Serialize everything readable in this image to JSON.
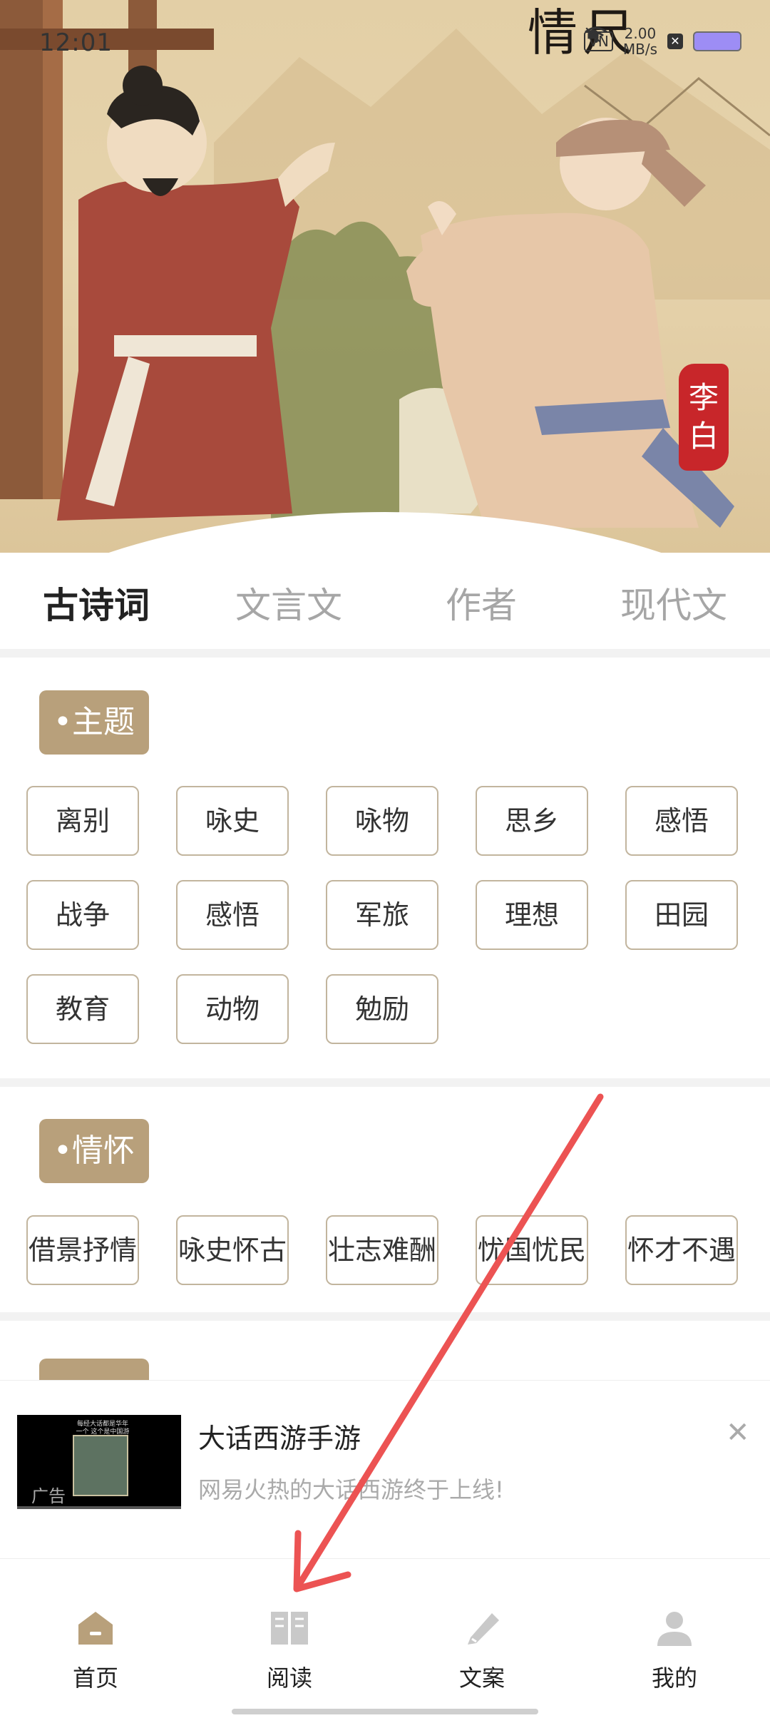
{
  "status_bar": {
    "time": "12:01",
    "vpn": "VN",
    "net_speed_value": "2.00",
    "net_speed_unit": "MB/s"
  },
  "hero": {
    "title_text": "情尺",
    "seal_line1": "李",
    "seal_line2": "白"
  },
  "tabs": [
    {
      "label": "古诗词",
      "active": true
    },
    {
      "label": "文言文",
      "active": false
    },
    {
      "label": "作者",
      "active": false
    },
    {
      "label": "现代文",
      "active": false
    }
  ],
  "sections": [
    {
      "label": "•主题",
      "chips": [
        "离别",
        "咏史",
        "咏物",
        "思乡",
        "感悟",
        "战争",
        "感悟",
        "军旅",
        "理想",
        "田园",
        "教育",
        "动物",
        "勉励"
      ]
    },
    {
      "label": "•情怀",
      "chips": [
        "借景抒情",
        "咏史怀古",
        "壮志难酬",
        "忧国忧民",
        "怀才不遇"
      ]
    }
  ],
  "ad": {
    "title": "大话西游手游",
    "description": "网易火热的大话西游终于上线!",
    "tag": "广告",
    "thumb_caption": "每经大话都是华年一个 这个是中国游戏",
    "close_icon": "close-icon"
  },
  "bottom_nav": [
    {
      "label": "首页",
      "icon": "home-icon"
    },
    {
      "label": "阅读",
      "icon": "book-icon"
    },
    {
      "label": "文案",
      "icon": "pen-icon"
    },
    {
      "label": "我的",
      "icon": "user-icon"
    }
  ],
  "colors": {
    "accent": "#b8a07b",
    "chip_border": "#c2b59e",
    "annotation_arrow": "#ec5353",
    "nav_icon": "#c9c9c9"
  }
}
